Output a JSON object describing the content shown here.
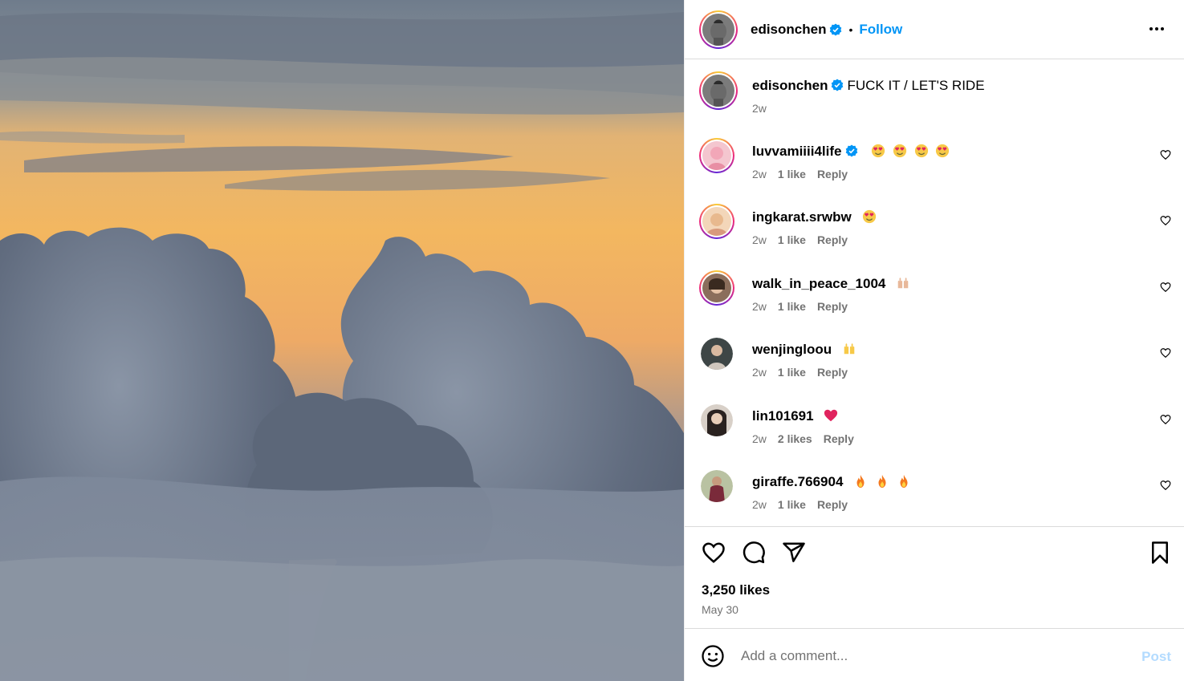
{
  "post": {
    "author": "edisonchen",
    "follow_label": "Follow",
    "separator": "•",
    "caption_text": "FUCK IT / LET'S RIDE",
    "caption_time": "2w",
    "likes": "3,250 likes",
    "date": "May 30"
  },
  "comments": [
    {
      "username": "luvvamiiii4life",
      "verified": true,
      "text": "",
      "emojis": [
        "heart-eyes",
        "heart-eyes",
        "heart-eyes",
        "heart-eyes"
      ],
      "time": "2w",
      "likes": "1 like",
      "reply": "Reply",
      "ring": true
    },
    {
      "username": "ingkarat.srwbw",
      "verified": false,
      "text": "",
      "emojis": [
        "heart-eyes"
      ],
      "time": "2w",
      "likes": "1 like",
      "reply": "Reply",
      "ring": true
    },
    {
      "username": "walk_in_peace_1004",
      "verified": false,
      "text": "",
      "emojis": [
        "raised-hands"
      ],
      "time": "2w",
      "likes": "1 like",
      "reply": "Reply",
      "ring": true
    },
    {
      "username": "wenjingloou",
      "verified": false,
      "text": "",
      "emojis": [
        "raised-hands-yellow"
      ],
      "time": "2w",
      "likes": "1 like",
      "reply": "Reply",
      "ring": false
    },
    {
      "username": "lin101691",
      "verified": false,
      "text": "",
      "emojis": [
        "red-heart"
      ],
      "time": "2w",
      "likes": "2 likes",
      "reply": "Reply",
      "ring": false
    },
    {
      "username": "giraffe.766904",
      "verified": false,
      "text": "",
      "emojis": [
        "fire",
        "fire",
        "fire"
      ],
      "time": "2w",
      "likes": "1 like",
      "reply": "Reply",
      "ring": false
    }
  ],
  "add_comment": {
    "placeholder": "Add a comment...",
    "post_label": "Post"
  },
  "colors": {
    "accent": "#0095f6",
    "muted": "#737373",
    "post_disabled": "#b3dbff",
    "border": "#dbdbdb"
  },
  "icons": {
    "verified": "verified-badge-icon",
    "more": "more-options-icon",
    "like": "heart-icon",
    "comment": "comment-bubble-icon",
    "share": "paper-plane-icon",
    "save": "bookmark-icon",
    "emoji": "smiley-icon"
  }
}
